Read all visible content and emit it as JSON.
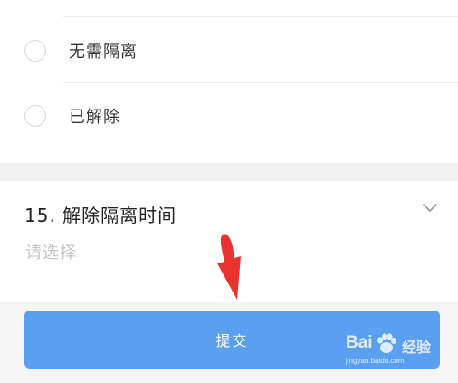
{
  "options": [
    {
      "label": "无需隔离",
      "selected": false
    },
    {
      "label": "已解除",
      "selected": false
    }
  ],
  "question": {
    "title": "15. 解除隔离时间",
    "placeholder": "请选择"
  },
  "submit": {
    "label": "提交"
  },
  "watermark": {
    "text_left": "Bai",
    "text_right": "经验",
    "subtext": "jingyan.baidu.com"
  },
  "colors": {
    "button": "#5b9ff0",
    "arrow": "#e8332e",
    "band": "#f2f2f2"
  }
}
